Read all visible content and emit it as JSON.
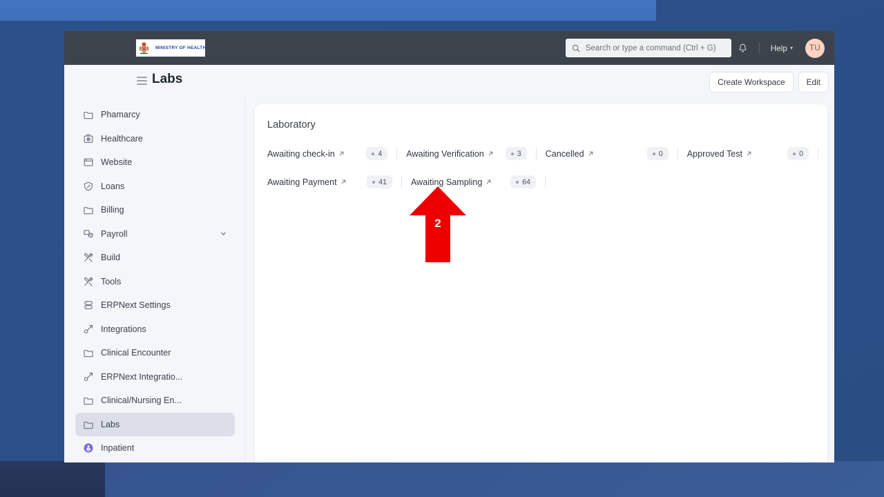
{
  "navbar": {
    "logo_text": "MINISTRY OF HEALTH",
    "logo_icon": "kenya-coat-of-arms-icon",
    "search_placeholder": "Search or type a command (Ctrl + G)",
    "search_value": "",
    "search_icon": "search-icon",
    "notification_icon": "bell-icon",
    "help_label": "Help",
    "help_caret": "▾",
    "avatar_initials": "TU"
  },
  "header": {
    "menu_icon": "hamburger-menu-icon",
    "title": "Labs",
    "create_workspace_label": "Create Workspace",
    "edit_label": "Edit"
  },
  "sidebar": {
    "items": [
      {
        "label": "Phamarcy",
        "icon": "folder-icon",
        "active": false,
        "expandable": false
      },
      {
        "label": "Healthcare",
        "icon": "medical-kit-icon",
        "active": false,
        "expandable": false
      },
      {
        "label": "Website",
        "icon": "browser-window-icon",
        "active": false,
        "expandable": false
      },
      {
        "label": "Loans",
        "icon": "loan-icon",
        "active": false,
        "expandable": false
      },
      {
        "label": "Billing",
        "icon": "folder-icon",
        "active": false,
        "expandable": false
      },
      {
        "label": "Payroll",
        "icon": "payroll-icon",
        "active": false,
        "expandable": true
      },
      {
        "label": "Build",
        "icon": "build-tools-icon",
        "active": false,
        "expandable": false
      },
      {
        "label": "Tools",
        "icon": "build-tools-icon",
        "active": false,
        "expandable": false
      },
      {
        "label": "ERPNext Settings",
        "icon": "server-icon",
        "active": false,
        "expandable": false
      },
      {
        "label": "Integrations",
        "icon": "integrations-icon",
        "active": false,
        "expandable": false
      },
      {
        "label": "Clinical Encounter",
        "icon": "folder-icon",
        "active": false,
        "expandable": false
      },
      {
        "label": "ERPNext Integratio...",
        "icon": "integrations-icon",
        "active": false,
        "expandable": false
      },
      {
        "label": "Clinical/Nursing En...",
        "icon": "folder-icon",
        "active": false,
        "expandable": false
      },
      {
        "label": "Labs",
        "icon": "folder-icon",
        "active": true,
        "expandable": false
      },
      {
        "label": "Inpatient",
        "icon": "inpatient-icon",
        "active": false,
        "expandable": false
      }
    ]
  },
  "workspace": {
    "section_title": "Laboratory",
    "shortcut_rows": [
      [
        {
          "label": "Awaiting check-in",
          "count": "4"
        },
        {
          "label": "Awaiting Verification",
          "count": "3"
        },
        {
          "label": "Cancelled",
          "count": "0"
        },
        {
          "label": "Approved Test",
          "count": "0"
        }
      ],
      [
        {
          "label": "Awaiting Payment",
          "count": "41"
        },
        {
          "label": "Awaiting Sampling",
          "count": "64"
        }
      ]
    ],
    "link_arrow_icon": "arrow-up-right-icon"
  },
  "annotation": {
    "number": "2",
    "color": "#ef0000",
    "icon": "arrow-up-annotation-icon",
    "points_at": "Awaiting Sampling"
  },
  "colors": {
    "navbar_bg": "#3c434c",
    "app_bg": "#f4f6fa",
    "card_bg": "#ffffff",
    "active_item_bg": "#dcdfe9",
    "desktop_blue": "#2e5390",
    "annotation_red": "#ef0000",
    "avatar_bg": "#fbd5c2",
    "logo_text_blue": "#1f3fa0"
  }
}
